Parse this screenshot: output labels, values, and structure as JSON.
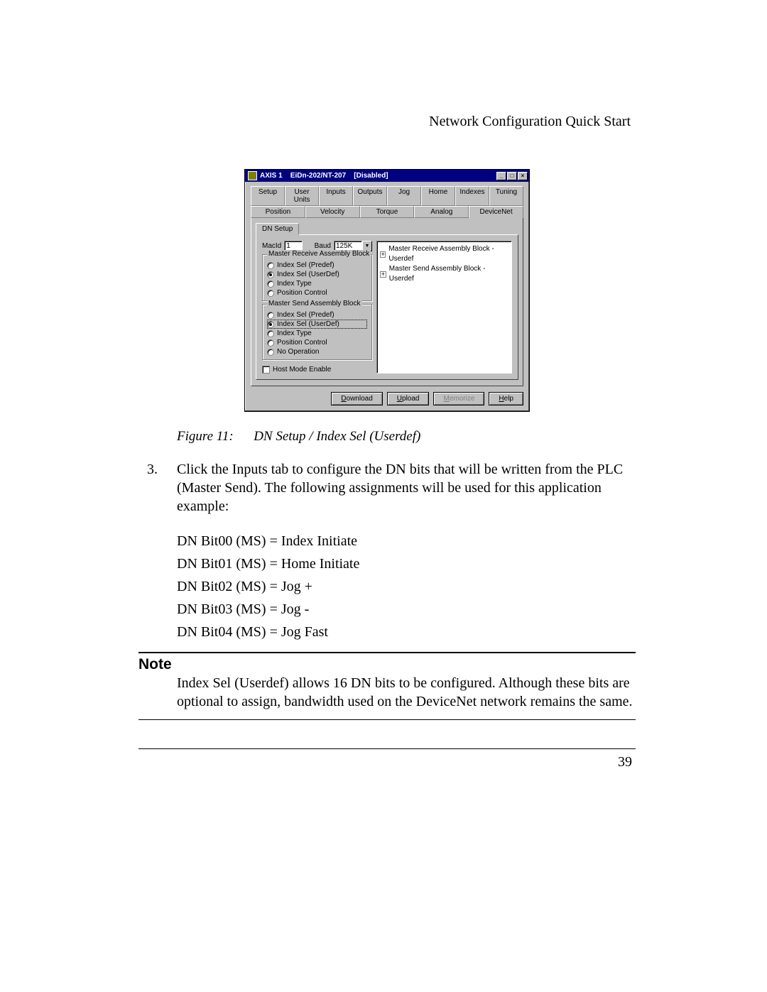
{
  "doc": {
    "header_right": "Network Configuration Quick Start",
    "figure_label": "Figure 11:",
    "figure_caption": "DN Setup / Index Sel (Userdef)",
    "step_number": "3.",
    "step_text": "Click the Inputs tab to configure the DN bits that will be written from the PLC (Master Send). The following assignments will be used for this application example:",
    "bits": [
      "DN Bit00 (MS) = Index Initiate",
      "DN Bit01 (MS) = Home Initiate",
      "DN Bit02 (MS) = Jog +",
      "DN Bit03 (MS) = Jog -",
      "DN Bit04 (MS) = Jog Fast"
    ],
    "note_heading": "Note",
    "note_body": "Index Sel (Userdef) allows 16 DN bits to be configured. Although these bits are optional to assign, bandwidth used on the DeviceNet network remains the same.",
    "page_number": "39"
  },
  "dialog": {
    "title": "AXIS 1    EiDn-202/NT-207    [Disabled]",
    "win_min": "_",
    "win_max": "□",
    "win_close": "×",
    "tabs_row1": [
      "Setup",
      "User Units",
      "Inputs",
      "Outputs",
      "Jog",
      "Home",
      "Indexes",
      "Tuning"
    ],
    "tabs_row2": [
      "Position",
      "Velocity",
      "Torque",
      "Analog",
      "DeviceNet"
    ],
    "sub_tab": "DN Setup",
    "macid_label": "MacId",
    "macid_value": "1",
    "baud_label": "Baud",
    "baud_value": "125K",
    "dropdown_glyph": "▼",
    "group_receive_title": "Master Receive Assembly Block",
    "receive_options": [
      {
        "label": "Index Sel (Predef)",
        "checked": false
      },
      {
        "label": "Index Sel (UserDef)",
        "checked": true
      },
      {
        "label": "Index Type",
        "checked": false
      },
      {
        "label": "Position Control",
        "checked": false
      }
    ],
    "group_send_title": "Master Send Assembly Block",
    "send_options": [
      {
        "label": "Index Sel (Predef)",
        "checked": false
      },
      {
        "label": "Index Sel (UserDef)",
        "checked": true,
        "focused": true
      },
      {
        "label": "Index Type",
        "checked": false
      },
      {
        "label": "Position Control",
        "checked": false
      },
      {
        "label": "No Operation",
        "checked": false
      }
    ],
    "host_mode_label": "Host Mode Enable",
    "plus_glyph": "+",
    "tree_items": [
      "Master Receive Assembly Block - Userdef",
      "Master Send Assembly Block - Userdef"
    ],
    "buttons": {
      "download": {
        "pre": "D",
        "rest": "ownload"
      },
      "upload": {
        "pre": "U",
        "rest": "pload"
      },
      "memorize": {
        "pre": "M",
        "rest": "emorize"
      },
      "help": {
        "pre": "H",
        "rest": "elp"
      }
    }
  }
}
